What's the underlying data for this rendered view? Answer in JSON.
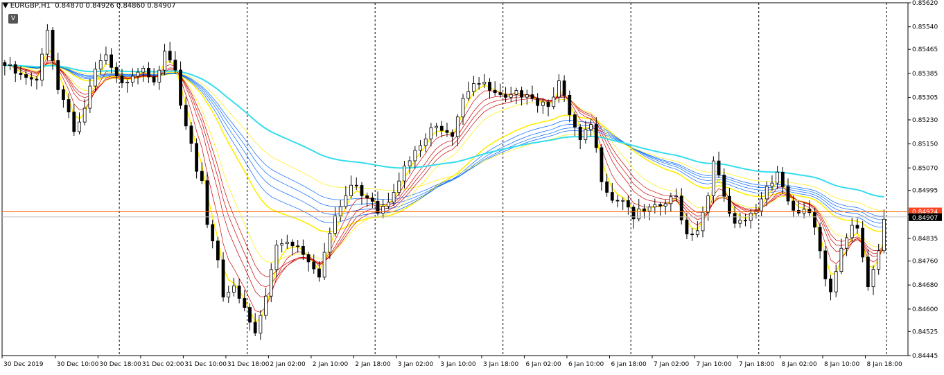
{
  "header": {
    "symbol": "EURGBP,H1",
    "open": "0.84870",
    "high": "0.84926",
    "low": "0.84860",
    "close": "0.84907",
    "button_label": "V",
    "arrow_icon": "triangle-down-icon"
  },
  "colors": {
    "background": "#ffffff",
    "axis": "#000000",
    "bid_line": "#ff6600",
    "ask_line": "#c0c0c0",
    "long_ma": "#33ddee",
    "fast_band_outer": "#ffee00",
    "fast_band_inner": "#cc0000",
    "slow_band_outer": "#ffee00",
    "slow_band_inner": "#0066ff",
    "bid_label_bg": "#ff4422",
    "last_label_bg": "#000000"
  },
  "price_labels": {
    "bid": "0.84924",
    "last": "0.84907"
  },
  "chart_data": {
    "type": "candlestick",
    "instrument": "EURGBP",
    "timeframe": "H1",
    "ylim": [
      0.84445,
      0.8562
    ],
    "y_ticks": [
      "0.85620",
      "0.85540",
      "0.85465",
      "0.85385",
      "0.85305",
      "0.85230",
      "0.85150",
      "0.85070",
      "0.84995",
      "0.84915",
      "0.84835",
      "0.84760",
      "0.84680",
      "0.84600",
      "0.84525",
      "0.84445"
    ],
    "x_ticks": [
      {
        "label": "30 Dec 2019",
        "bar": 0
      },
      {
        "label": "30 Dec 10:00",
        "bar": 10
      },
      {
        "label": "30 Dec 18:00",
        "bar": 18
      },
      {
        "label": "31 Dec 02:00",
        "bar": 26
      },
      {
        "label": "31 Dec 10:00",
        "bar": 34
      },
      {
        "label": "31 Dec 18:00",
        "bar": 42
      },
      {
        "label": "2 Jan 02:00",
        "bar": 50
      },
      {
        "label": "2 Jan 10:00",
        "bar": 58
      },
      {
        "label": "2 Jan 18:00",
        "bar": 66
      },
      {
        "label": "3 Jan 02:00",
        "bar": 74
      },
      {
        "label": "3 Jan 10:00",
        "bar": 82
      },
      {
        "label": "3 Jan 18:00",
        "bar": 90
      },
      {
        "label": "6 Jan 02:00",
        "bar": 98
      },
      {
        "label": "6 Jan 10:00",
        "bar": 106
      },
      {
        "label": "6 Jan 18:00",
        "bar": 114
      },
      {
        "label": "7 Jan 02:00",
        "bar": 122
      },
      {
        "label": "7 Jan 10:00",
        "bar": 130
      },
      {
        "label": "7 Jan 18:00",
        "bar": 138
      },
      {
        "label": "8 Jan 02:00",
        "bar": 146
      },
      {
        "label": "8 Jan 10:00",
        "bar": 154
      },
      {
        "label": "8 Jan 18:00",
        "bar": 162
      }
    ],
    "separators": [
      22,
      46,
      70,
      94,
      118,
      142,
      166
    ],
    "close_path": [
      [
        0,
        0.8542
      ],
      [
        3,
        0.8538
      ],
      [
        6,
        0.8536
      ],
      [
        8,
        0.8555
      ],
      [
        10,
        0.8534
      ],
      [
        12,
        0.8528
      ],
      [
        13,
        0.852
      ],
      [
        15,
        0.8527
      ],
      [
        17,
        0.854
      ],
      [
        19,
        0.8545
      ],
      [
        20,
        0.854
      ],
      [
        22,
        0.8535
      ],
      [
        24,
        0.854
      ],
      [
        26,
        0.8542
      ],
      [
        28,
        0.8538
      ],
      [
        30,
        0.8545
      ],
      [
        32,
        0.854
      ],
      [
        33,
        0.8528
      ],
      [
        35,
        0.8515
      ],
      [
        36,
        0.8505
      ],
      [
        37,
        0.8502
      ],
      [
        38,
        0.849
      ],
      [
        40,
        0.8478
      ],
      [
        41,
        0.8465
      ],
      [
        43,
        0.847
      ],
      [
        45,
        0.846
      ],
      [
        47,
        0.8452
      ],
      [
        49,
        0.8465
      ],
      [
        51,
        0.8482
      ],
      [
        53,
        0.8484
      ],
      [
        55,
        0.8482
      ],
      [
        57,
        0.8478
      ],
      [
        59,
        0.8473
      ],
      [
        61,
        0.8486
      ],
      [
        63,
        0.8495
      ],
      [
        65,
        0.8502
      ],
      [
        67,
        0.85
      ],
      [
        69,
        0.8498
      ],
      [
        70,
        0.8494
      ],
      [
        72,
        0.8498
      ],
      [
        74,
        0.8505
      ],
      [
        76,
        0.851
      ],
      [
        78,
        0.8515
      ],
      [
        80,
        0.852
      ],
      [
        82,
        0.8522
      ],
      [
        84,
        0.852
      ],
      [
        85,
        0.8526
      ],
      [
        86,
        0.8532
      ],
      [
        88,
        0.8537
      ],
      [
        90,
        0.8535
      ],
      [
        92,
        0.8532
      ],
      [
        94,
        0.853
      ],
      [
        96,
        0.8532
      ],
      [
        98,
        0.8534
      ],
      [
        100,
        0.853
      ],
      [
        102,
        0.853
      ],
      [
        104,
        0.8536
      ],
      [
        106,
        0.8525
      ],
      [
        108,
        0.8516
      ],
      [
        110,
        0.8522
      ],
      [
        112,
        0.8505
      ],
      [
        114,
        0.8498
      ],
      [
        116,
        0.8498
      ],
      [
        118,
        0.8492
      ],
      [
        120,
        0.8493
      ],
      [
        122,
        0.8494
      ],
      [
        124,
        0.8496
      ],
      [
        126,
        0.8498
      ],
      [
        128,
        0.8486
      ],
      [
        130,
        0.8488
      ],
      [
        132,
        0.8499
      ],
      [
        133,
        0.8512
      ],
      [
        135,
        0.8497
      ],
      [
        137,
        0.8488
      ],
      [
        139,
        0.849
      ],
      [
        141,
        0.8494
      ],
      [
        143,
        0.8502
      ],
      [
        145,
        0.8507
      ],
      [
        147,
        0.8497
      ],
      [
        149,
        0.8492
      ],
      [
        151,
        0.8493
      ],
      [
        152,
        0.8488
      ],
      [
        154,
        0.847
      ],
      [
        155,
        0.8465
      ],
      [
        157,
        0.8482
      ],
      [
        159,
        0.849
      ],
      [
        160,
        0.8488
      ],
      [
        162,
        0.847
      ],
      [
        164,
        0.848
      ],
      [
        165,
        0.849
      ]
    ]
  }
}
